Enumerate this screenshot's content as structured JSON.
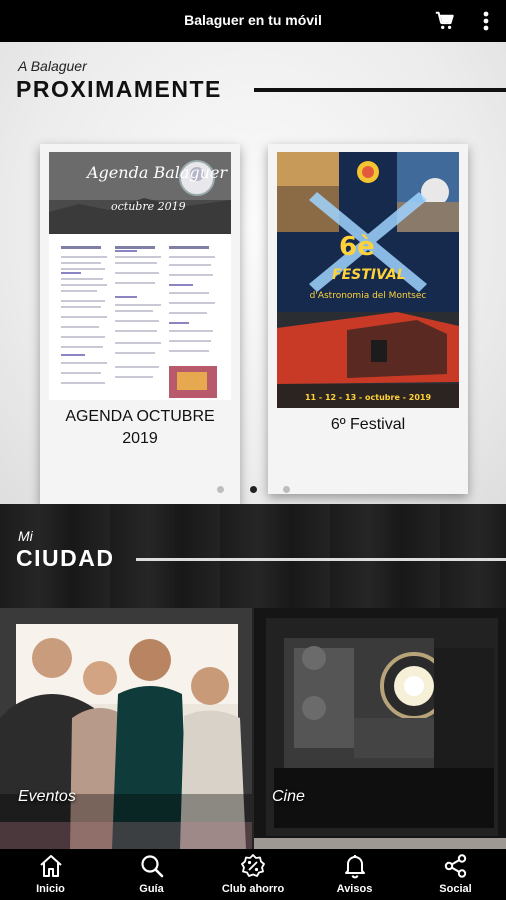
{
  "appbar": {
    "title": "Balaguer en tu móvil",
    "cart_icon": "shopping-cart-icon",
    "menu_icon": "more-vert-icon"
  },
  "upcoming": {
    "kicker": "A Balaguer",
    "heading": "PROXIMAMENTE",
    "cards": [
      {
        "title_line1": "AGENDA OCTUBRE",
        "title_line2": "2019",
        "poster": {
          "title": "Agenda Balaguer",
          "subtitle": "octubre 2019"
        }
      },
      {
        "title": "6º Festival",
        "poster": {
          "big": "6è",
          "festival": "FESTIVAL",
          "sub": "d'Astronomia del Montsec",
          "dates": "11 - 12 - 13 - octubre - 2019"
        }
      }
    ],
    "pager": {
      "count": 3,
      "active": 2
    }
  },
  "city": {
    "kicker": "Mi",
    "heading": "CIUDAD",
    "tiles": [
      {
        "label": "Eventos"
      },
      {
        "label": "Cine"
      }
    ]
  },
  "nav": [
    {
      "label": "Inicio",
      "icon": "home-icon"
    },
    {
      "label": "Guía",
      "icon": "search-icon"
    },
    {
      "label": "Club ahorro",
      "icon": "discount-icon"
    },
    {
      "label": "Avisos",
      "icon": "bell-icon"
    },
    {
      "label": "Social",
      "icon": "share-icon"
    }
  ],
  "colors": {
    "bar": "#000000",
    "poster_blue": "#152a4d",
    "poster_red": "#c83a26",
    "accent_yellow": "#ffd23a"
  }
}
